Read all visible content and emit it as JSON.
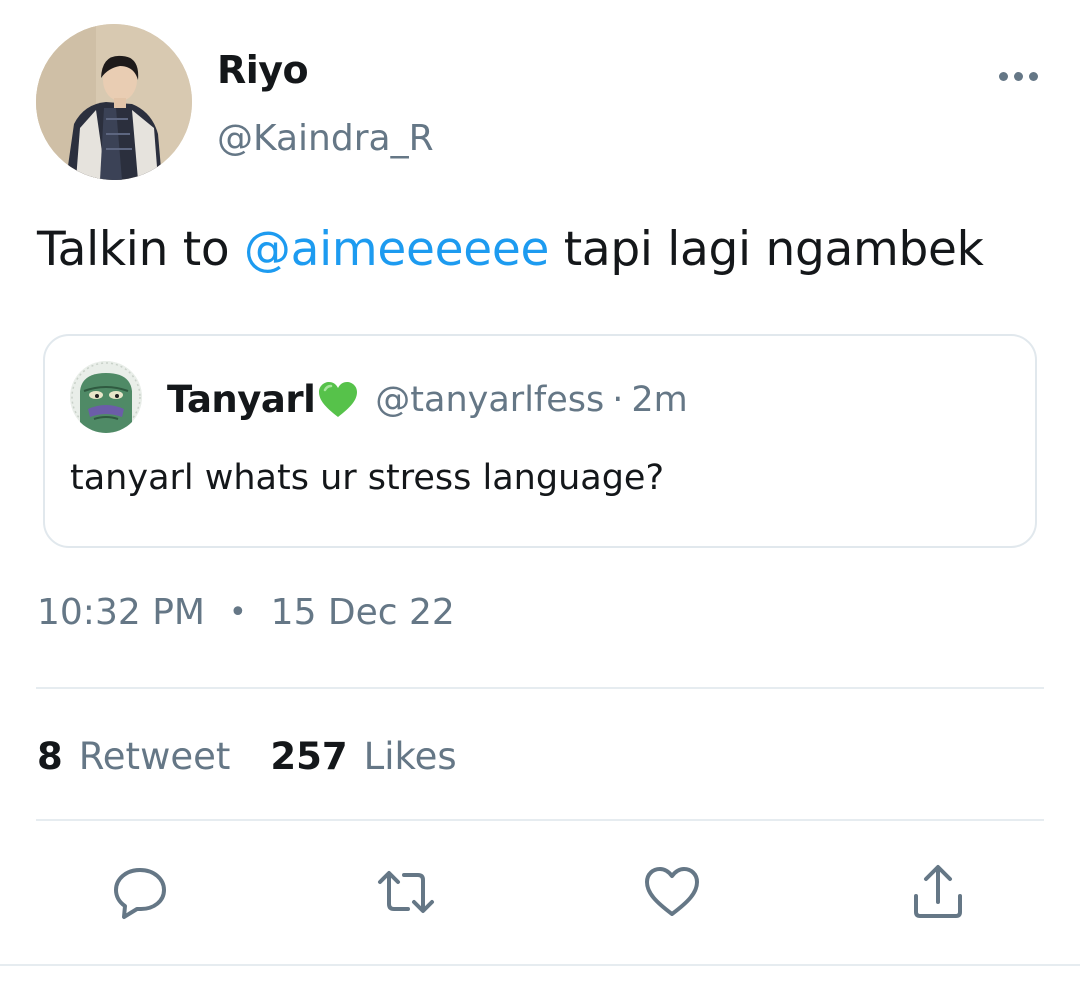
{
  "author": {
    "display_name": "Riyo",
    "handle": "@Kaindra_R"
  },
  "tweet": {
    "text_before": "Talkin to ",
    "mention": "@aimeeeeee",
    "text_after": " tapi lagi ngambek"
  },
  "quote": {
    "display_name": "Tanyarl",
    "badge_icon": "green-heart-icon",
    "handle": "@tanyarlfess",
    "separator": "·",
    "time": "2m",
    "text": "tanyarl whats ur stress language?"
  },
  "meta": {
    "time": "10:32 PM",
    "separator": "•",
    "date": "15 Dec 22"
  },
  "stats": {
    "retweets_count": "8",
    "retweets_label": "Retweet",
    "likes_count": "257",
    "likes_label": "Likes"
  },
  "actions": [
    "reply-icon",
    "retweet-icon",
    "like-icon",
    "share-icon"
  ],
  "colors": {
    "accent": "#1d9bf0",
    "secondary_text": "#657786",
    "primary_text": "#14171a",
    "border": "#e1e8ed"
  }
}
